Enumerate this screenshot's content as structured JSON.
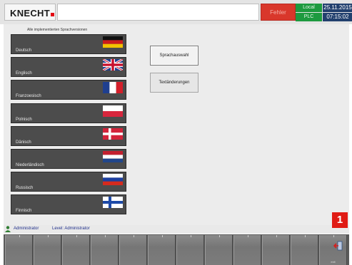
{
  "header": {
    "logo_text": "KNECHT",
    "brand_color": "#e30613",
    "title": "",
    "error_label": "Fehler",
    "status_top": "Local",
    "status_bottom": "PLC",
    "date": "25.11.2015",
    "time": "07:15:02"
  },
  "languages": {
    "header": "Alle implementierten Sprachversionen",
    "items": [
      {
        "label": "Deutsch",
        "flag": "germany-flag-icon"
      },
      {
        "label": "Englisch",
        "flag": "uk-flag-icon"
      },
      {
        "label": "Franzoesisch",
        "flag": "france-flag-icon"
      },
      {
        "label": "Polnisch",
        "flag": "poland-flag-icon"
      },
      {
        "label": "Dänisch",
        "flag": "denmark-flag-icon"
      },
      {
        "label": "Niederländisch",
        "flag": "netherlands-flag-icon"
      },
      {
        "label": "Russisch",
        "flag": "russia-flag-icon"
      },
      {
        "label": "Finnisch",
        "flag": "finland-flag-icon"
      }
    ]
  },
  "side_buttons": {
    "language_select": "Sprachauswahl",
    "text_changes": "Textänderungen"
  },
  "status": {
    "user": "Administrator",
    "level": "Level: Administrator"
  },
  "function_keys": {
    "count": 12,
    "last_label": "exit"
  },
  "callout": "1"
}
